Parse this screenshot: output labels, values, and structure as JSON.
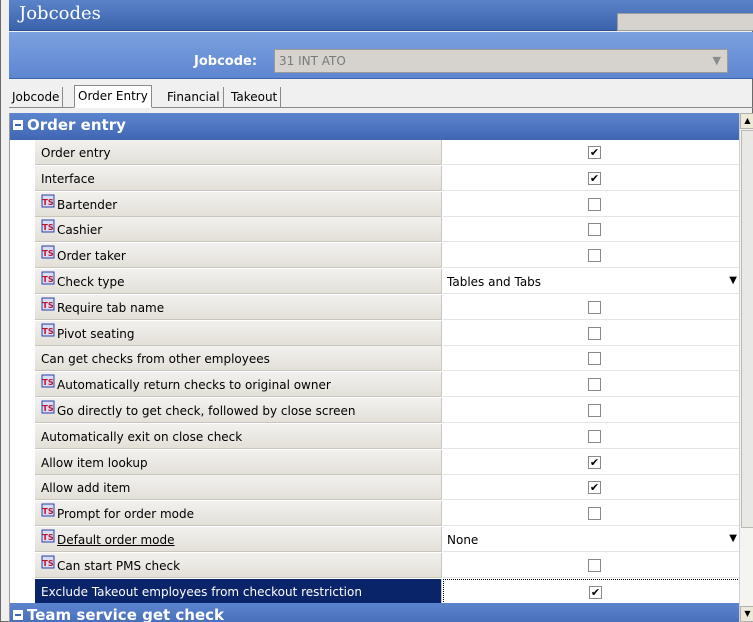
{
  "window": {
    "title": "Jobcodes"
  },
  "header": {
    "jobcode_label": "Jobcode:",
    "jobcode_value": "31 INT ATO"
  },
  "tabs": [
    {
      "label": "Jobcode"
    },
    {
      "label": "Order Entry",
      "active": true
    },
    {
      "label": "Financial"
    },
    {
      "label": "Takeout"
    }
  ],
  "sections": [
    {
      "title": "Order entry"
    },
    {
      "title": "Team service get check"
    }
  ],
  "rows": [
    {
      "label": "Order entry",
      "type": "checkbox",
      "checked": true,
      "ts_icon": false
    },
    {
      "label": "Interface",
      "type": "checkbox",
      "checked": true,
      "ts_icon": false
    },
    {
      "label": "Bartender",
      "type": "checkbox",
      "checked": false,
      "ts_icon": true
    },
    {
      "label": "Cashier",
      "type": "checkbox",
      "checked": false,
      "ts_icon": true
    },
    {
      "label": "Order taker",
      "type": "checkbox",
      "checked": false,
      "ts_icon": true
    },
    {
      "label": "Check type",
      "type": "dropdown",
      "value": "Tables and Tabs",
      "ts_icon": true
    },
    {
      "label": "Require tab name",
      "type": "checkbox",
      "checked": false,
      "ts_icon": true
    },
    {
      "label": "Pivot seating",
      "type": "checkbox",
      "checked": false,
      "ts_icon": true
    },
    {
      "label": "Can get checks from other employees",
      "type": "checkbox",
      "checked": false,
      "ts_icon": false
    },
    {
      "label": "Automatically return checks to original owner",
      "type": "checkbox",
      "checked": false,
      "ts_icon": true
    },
    {
      "label": "Go directly to get check, followed by close screen",
      "type": "checkbox",
      "checked": false,
      "ts_icon": true
    },
    {
      "label": "Automatically exit on close check",
      "type": "checkbox",
      "checked": false,
      "ts_icon": false
    },
    {
      "label": "Allow item lookup",
      "type": "checkbox",
      "checked": true,
      "ts_icon": false
    },
    {
      "label": "Allow add item",
      "type": "checkbox",
      "checked": true,
      "ts_icon": false
    },
    {
      "label": "Prompt for order mode",
      "type": "checkbox",
      "checked": false,
      "ts_icon": true
    },
    {
      "label": "Default order mode",
      "type": "dropdown",
      "value": "None",
      "ts_icon": true,
      "underline": true
    },
    {
      "label": "Can start PMS check",
      "type": "checkbox",
      "checked": false,
      "ts_icon": true
    },
    {
      "label": "Exclude Takeout employees from checkout restriction",
      "type": "checkbox",
      "checked": true,
      "ts_icon": false,
      "selected": true
    }
  ],
  "icons": {
    "check_mark": "✔",
    "dropdown_arrow": "▼",
    "scroll_up": "▲",
    "scroll_down": "▼",
    "ts_icon_text": "TS"
  },
  "colors": {
    "accent": "#3f66b2",
    "selected_row": "#0a246a"
  }
}
